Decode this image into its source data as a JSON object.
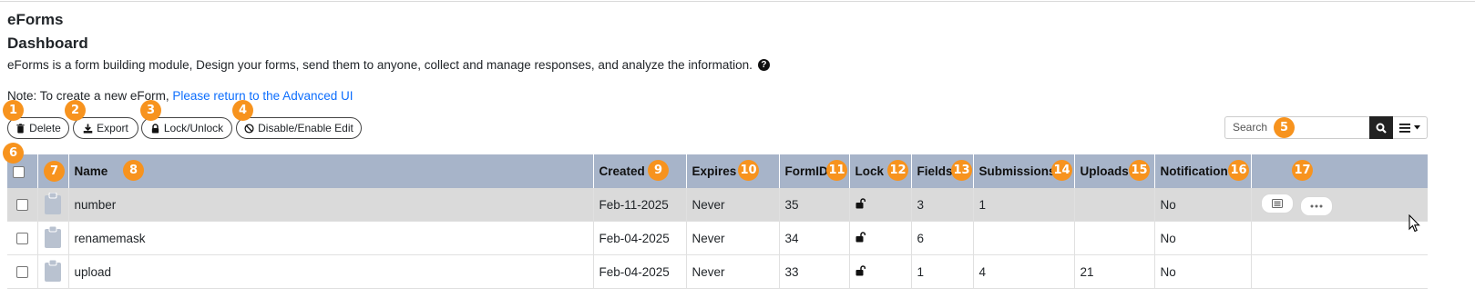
{
  "header": {
    "app_title": "eForms",
    "page_title": "Dashboard",
    "description": "eForms is a form building module, Design your forms, send them to anyone, collect and manage responses, and analyze the information.",
    "note_prefix": "Note: To create a new eForm,",
    "note_link": "Please return to the Advanced UI"
  },
  "toolbar": {
    "delete_label": "Delete",
    "export_label": "Export",
    "lock_label": "Lock/Unlock",
    "disable_label": "Disable/Enable Edit"
  },
  "search": {
    "placeholder": "Search"
  },
  "badges": [
    "1",
    "2",
    "3",
    "4",
    "5",
    "6",
    "7",
    "8",
    "9",
    "10",
    "11",
    "12",
    "13",
    "14",
    "15",
    "16",
    "17"
  ],
  "table": {
    "columns": {
      "name": "Name",
      "created": "Created",
      "expires": "Expires",
      "formid": "FormID",
      "lock": "Lock",
      "fields": "Fields",
      "submissions": "Submissions",
      "uploads": "Uploads",
      "notification": "Notification"
    },
    "rows": [
      {
        "name": "number",
        "created": "Feb-11-2025",
        "expires": "Never",
        "formid": "35",
        "fields": "3",
        "submissions": "1",
        "uploads": "",
        "notification": "No"
      },
      {
        "name": "renamemask",
        "created": "Feb-04-2025",
        "expires": "Never",
        "formid": "34",
        "fields": "6",
        "submissions": "",
        "uploads": "",
        "notification": "No"
      },
      {
        "name": "upload",
        "created": "Feb-04-2025",
        "expires": "Never",
        "formid": "33",
        "fields": "1",
        "submissions": "4",
        "uploads": "21",
        "notification": "No"
      }
    ]
  },
  "colors": {
    "header_bg": "#a7b4c9",
    "badge": "#f7931e",
    "link": "#0d6efd",
    "highlight_row": "#dadada"
  }
}
